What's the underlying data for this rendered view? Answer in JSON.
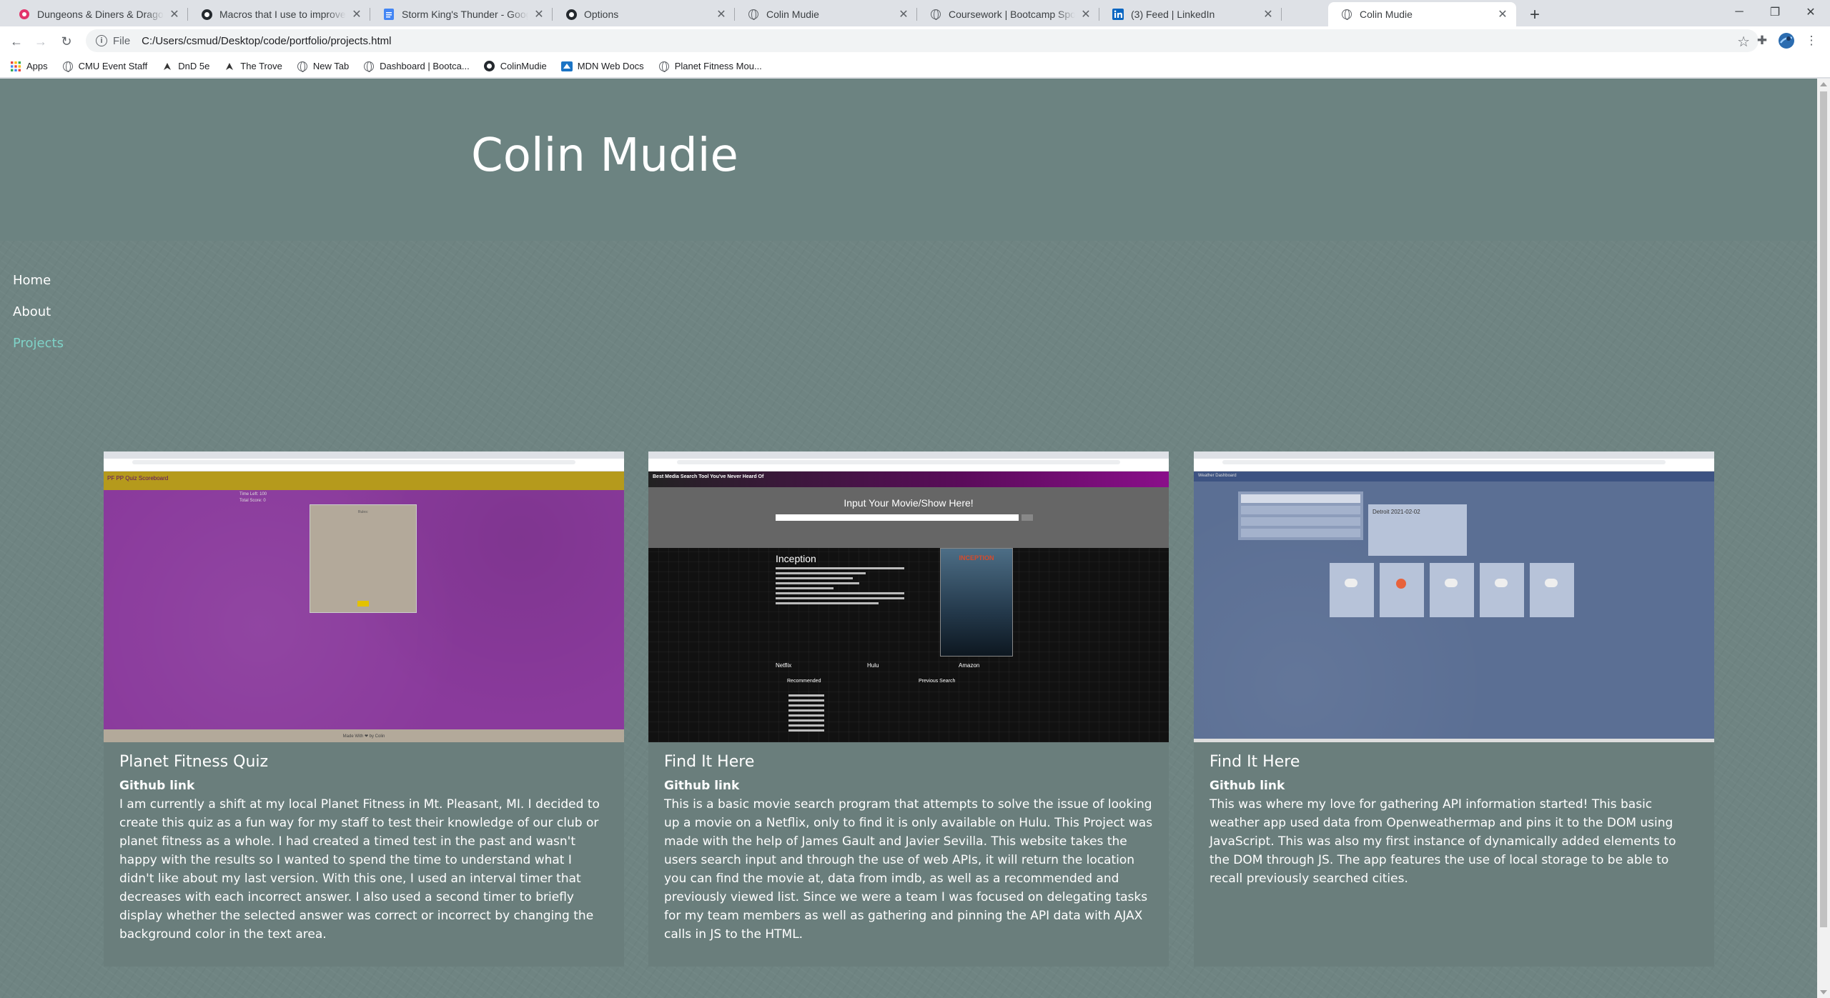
{
  "browser": {
    "tabs": [
      {
        "title": "Dungeons & Diners & Dragons",
        "favicon": "dnd-icon",
        "active": false
      },
      {
        "title": "Macros that I use to improve my",
        "favicon": "github-icon",
        "active": false
      },
      {
        "title": "Storm King's Thunder - Google D",
        "favicon": "google-docs-icon",
        "active": false
      },
      {
        "title": "Options",
        "favicon": "github-icon",
        "active": false
      },
      {
        "title": "Colin Mudie",
        "favicon": "globe-icon",
        "active": false
      },
      {
        "title": "Coursework | Bootcamp Spot",
        "favicon": "globe-icon",
        "active": false
      },
      {
        "title": "(3) Feed | LinkedIn",
        "favicon": "linkedin-icon",
        "active": false
      },
      {
        "title": "Colin Mudie",
        "favicon": "globe-icon",
        "active": true
      }
    ],
    "address": {
      "scheme": "File",
      "url": "C:/Users/csmud/Desktop/code/portfolio/projects.html"
    },
    "bookmarks": [
      {
        "label": "Apps",
        "icon": "apps-grid-icon"
      },
      {
        "label": "CMU Event Staff",
        "icon": "globe-icon"
      },
      {
        "label": "DnD 5e",
        "icon": "dnd-icon"
      },
      {
        "label": "The Trove",
        "icon": "dnd-icon"
      },
      {
        "label": "New Tab",
        "icon": "globe-icon"
      },
      {
        "label": "Dashboard | Bootca...",
        "icon": "globe-icon"
      },
      {
        "label": "ColinMudie",
        "icon": "github-icon"
      },
      {
        "label": "MDN Web Docs",
        "icon": "mdn-icon"
      },
      {
        "label": "Planet Fitness Mou...",
        "icon": "globe-icon"
      }
    ]
  },
  "site": {
    "title": "Colin Mudie",
    "nav": [
      {
        "label": "Home",
        "current": false
      },
      {
        "label": "About",
        "current": false
      },
      {
        "label": "Projects",
        "current": true
      }
    ],
    "colors": {
      "background": "#6f8482",
      "accent": "#7fd3c8",
      "card": "#6a7e7c"
    }
  },
  "projects": [
    {
      "title": "Planet Fitness Quiz",
      "link": "Github link",
      "screenshot": {
        "nav_text": "PF PP Quiz  Scoreboard",
        "timer": [
          "Time Left: 100",
          "Total Score: 0"
        ],
        "rules_title": "Rules:",
        "footer": "Made With ❤ by Colin"
      },
      "description": "I am currently a shift at my local Planet Fitness in Mt. Pleasant, MI. I decided to create this quiz as a fun way for my staff to test their knowledge of our club or planet fitness as a whole. I had created a timed test in the past and wasn't happy with the results so I wanted to spend the time to understand what I didn't like about my last version. With this one, I used an interval timer that decreases with each incorrect answer. I also used a second timer to briefly display whether the selected answer was correct or incorrect by changing the background color in the text area."
    },
    {
      "title": "Find It Here",
      "link": "Github link",
      "screenshot": {
        "nav_text": "Best Media Search Tool You've Never Heard Of",
        "search_label": "Input Your Movie/Show Here!",
        "movie_title": "Inception",
        "poster_text": "INCEPTION",
        "columns": [
          "Netflix",
          "Hulu",
          "Amazon"
        ],
        "lists": [
          "Recommended",
          "Previous Search"
        ]
      },
      "description": "This is a basic movie search program that attempts to solve the issue of looking up a movie on a Netflix, only to find it is only available on Hulu. This Project was made with the help of James Gault and Javier Sevilla. This website takes the users search input and through the use of web APIs, it will return the location you can find the movie at, data from imdb, as well as a recommended and previously viewed list. Since we were a team I was focused on delegating tasks for my team members as well as gathering and pinning the API data with AJAX calls in JS to the HTML."
    },
    {
      "title": "Find It Here",
      "link": "Github link",
      "screenshot": {
        "nav_text": "Weather Dashboard",
        "today": "Detroit 2021-02-02"
      },
      "description": "This was where my love for gathering API information started! This basic weather app used data from Openweathermap and pins it to the DOM using JavaScript. This was also my first instance of dynamically added elements to the DOM through JS. The app features the use of local storage to be able to recall previously searched cities."
    }
  ]
}
